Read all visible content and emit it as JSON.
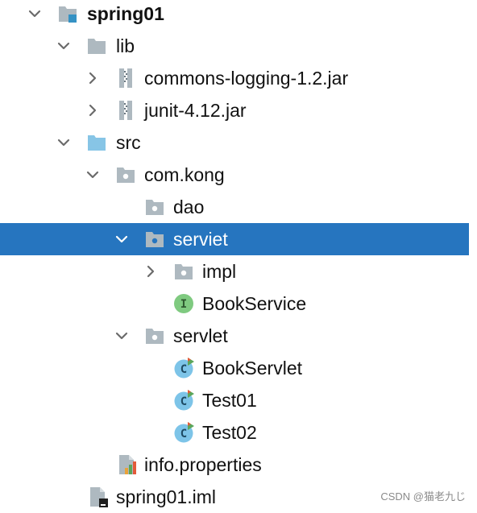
{
  "tree": {
    "rows": [
      {
        "label": "spring01",
        "icon": "module-folder-icon",
        "expanded": true
      },
      {
        "label": "lib",
        "icon": "folder-icon",
        "expanded": true
      },
      {
        "label": "commons-logging-1.2.jar",
        "icon": "jar-archive-icon",
        "expanded": false
      },
      {
        "label": "junit-4.12.jar",
        "icon": "jar-archive-icon",
        "expanded": false
      },
      {
        "label": "src",
        "icon": "source-folder-icon",
        "expanded": true
      },
      {
        "label": "com.kong",
        "icon": "package-icon",
        "expanded": true
      },
      {
        "label": "dao",
        "icon": "package-icon"
      },
      {
        "label": "serviet",
        "icon": "package-icon",
        "expanded": true,
        "selected": true
      },
      {
        "label": "impl",
        "icon": "package-icon",
        "expanded": false
      },
      {
        "label": "BookService",
        "icon": "interface-icon",
        "icon_letter": "I"
      },
      {
        "label": "servlet",
        "icon": "package-icon",
        "expanded": true
      },
      {
        "label": "BookServlet",
        "icon": "runnable-class-icon",
        "icon_letter": "C"
      },
      {
        "label": "Test01",
        "icon": "runnable-class-icon",
        "icon_letter": "C"
      },
      {
        "label": "Test02",
        "icon": "runnable-class-icon",
        "icon_letter": "C"
      },
      {
        "label": "info.properties",
        "icon": "properties-file-icon"
      },
      {
        "label": "spring01.iml",
        "icon": "iml-file-icon"
      }
    ]
  },
  "watermark": "CSDN @猫老九じ",
  "colors": {
    "selection": "#2675bf",
    "folder": "#aeb9c0",
    "source_folder": "#87c5e6",
    "module_accent": "#3592c4",
    "interface_icon": "#7fca80",
    "class_icon": "#7dc4e8",
    "run_marker": "#5ba65b",
    "run_marker_alt": "#e35a3a"
  }
}
